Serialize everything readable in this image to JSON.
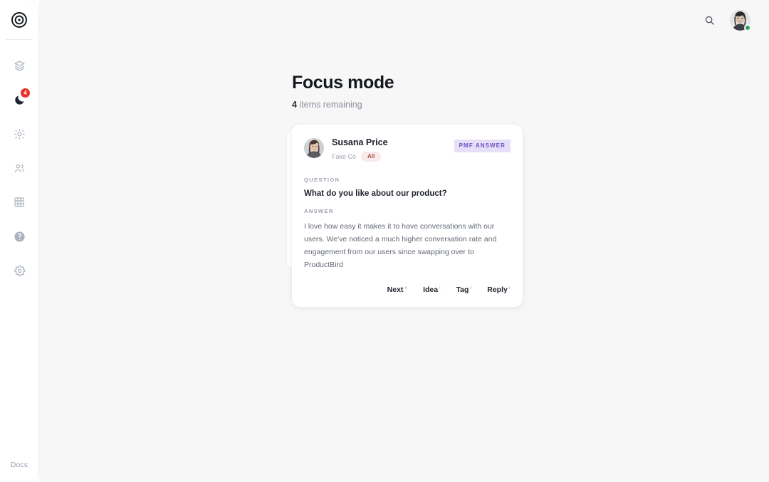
{
  "sidebar": {
    "logo": {
      "icon": "target-logo-icon"
    },
    "items": [
      {
        "icon": "layers-icon",
        "name": "sidebar-item-layers",
        "active": false,
        "badge": ""
      },
      {
        "icon": "moon-icon",
        "name": "sidebar-item-focus-mode",
        "active": true,
        "badge": "4"
      },
      {
        "icon": "sparkle-icon",
        "name": "sidebar-item-insights",
        "active": false,
        "badge": ""
      },
      {
        "icon": "users-icon",
        "name": "sidebar-item-people",
        "active": false,
        "badge": ""
      },
      {
        "icon": "grid-icon",
        "name": "sidebar-item-grid",
        "active": false,
        "badge": ""
      },
      {
        "icon": "help-circle-icon",
        "name": "sidebar-item-help",
        "active": false,
        "badge": ""
      },
      {
        "icon": "gear-icon",
        "name": "sidebar-item-settings",
        "active": false,
        "badge": ""
      }
    ],
    "docs_label": "Docs"
  },
  "topbar": {
    "search_icon": "search-icon",
    "avatar_icon": "user-avatar",
    "status": "online"
  },
  "page": {
    "title": "Focus mode",
    "count": "4",
    "subtitle_rest": " items remaining"
  },
  "card": {
    "person_name": "Susana Price",
    "company": "Fake Co",
    "pill_label": "All",
    "type_badge": "PMF ANSWER",
    "question_label": "Question",
    "question_text": "What do you like about our product?",
    "answer_label": "Answer",
    "answer_text": "I love how easy it makes it to have conversations with our users. We've noticed a much higher conversation rate and engagement from our users since swapping over to ProductBird",
    "actions": [
      {
        "label": "Next",
        "shortcut": "n",
        "name": "next-button"
      },
      {
        "label": "Idea",
        "shortcut": "i",
        "name": "idea-button"
      },
      {
        "label": "Tag",
        "shortcut": "t",
        "name": "tag-button"
      },
      {
        "label": "Reply",
        "shortcut": "r",
        "name": "reply-button"
      }
    ]
  },
  "colors": {
    "accent_purple": "#6d4fc4",
    "badge_red": "#e8302a",
    "status_green": "#2fa360",
    "pill_pink_text": "#a4554f",
    "background": "#f7f7f8"
  }
}
